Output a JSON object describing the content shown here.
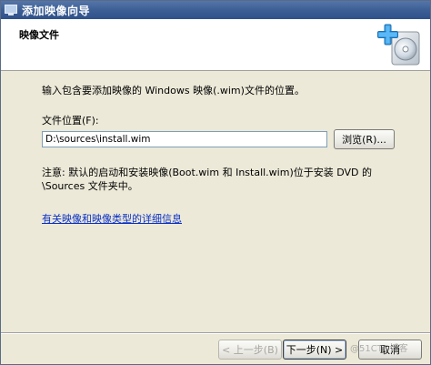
{
  "window": {
    "title": "添加映像向导"
  },
  "header": {
    "title": "映像文件",
    "icon": "add-disc-icon"
  },
  "main": {
    "instruction": "输入包含要添加映像的 Windows 映像(.wim)文件的位置。",
    "file_location_label": "文件位置(F):",
    "file_path_value": "D:\\sources\\install.wim",
    "browse_label": "浏览(R)...",
    "note_line1": "注意: 默认的启动和安装映像(Boot.wim 和 Install.wim)位于安装 DVD 的",
    "note_line2": "\\Sources 文件夹中。",
    "info_link": "有关映像和映像类型的详细信息"
  },
  "footer": {
    "back_label": "< 上一步(B)",
    "next_label": "下一步(N) >",
    "cancel_label": "取消"
  },
  "watermark": "@51CTO博客",
  "colors": {
    "titlebar": "#3c5f96",
    "dialog_bg": "#ece9d8",
    "link": "#0b31c7"
  }
}
